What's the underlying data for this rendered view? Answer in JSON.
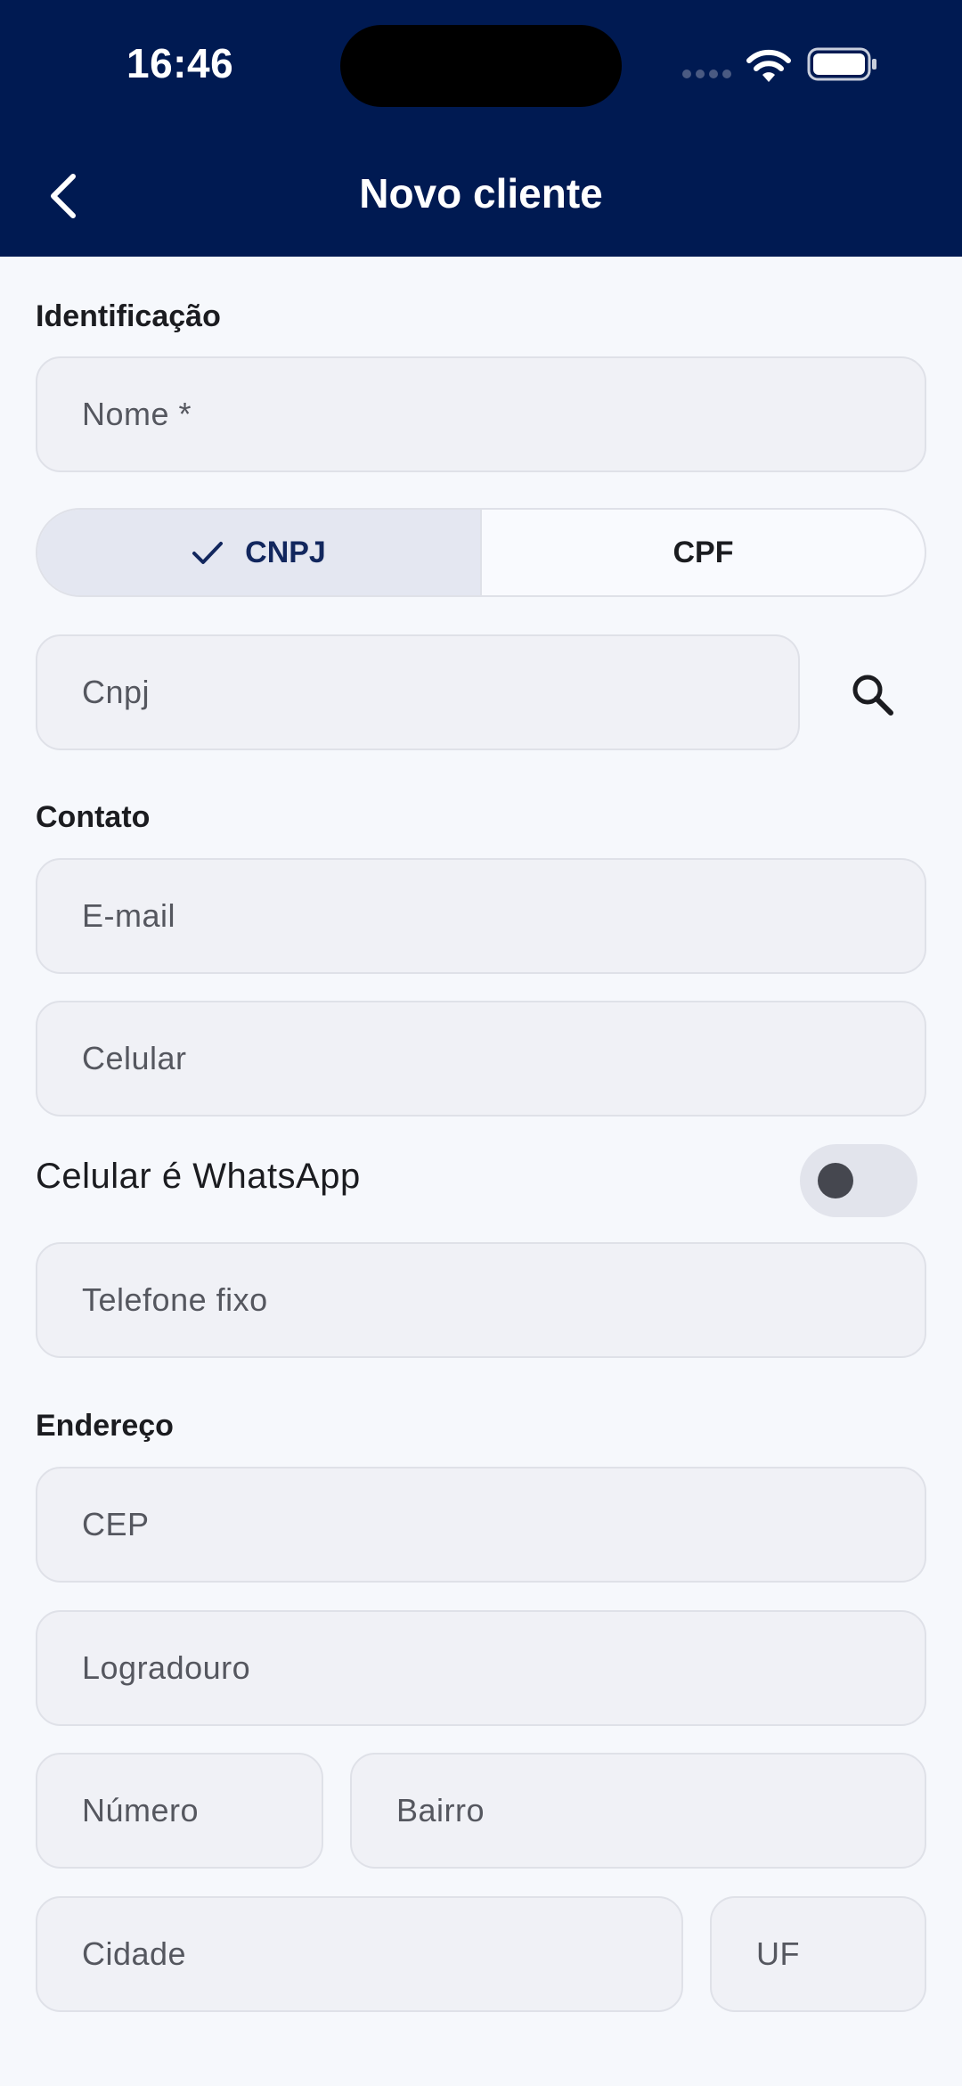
{
  "status_bar": {
    "time": "16:46"
  },
  "header": {
    "title": "Novo cliente"
  },
  "sections": {
    "identificacao": "Identificação",
    "contato": "Contato",
    "endereco": "Endereço"
  },
  "fields": {
    "nome": {
      "placeholder": "Nome *",
      "value": ""
    },
    "cnpj": {
      "placeholder": "Cnpj",
      "value": ""
    },
    "email": {
      "placeholder": "E-mail",
      "value": ""
    },
    "celular": {
      "placeholder": "Celular",
      "value": ""
    },
    "telefone": {
      "placeholder": "Telefone fixo",
      "value": ""
    },
    "cep": {
      "placeholder": "CEP",
      "value": ""
    },
    "logradouro": {
      "placeholder": "Logradouro",
      "value": ""
    },
    "numero": {
      "placeholder": "Número",
      "value": ""
    },
    "bairro": {
      "placeholder": "Bairro",
      "value": ""
    },
    "cidade": {
      "placeholder": "Cidade",
      "value": ""
    },
    "uf": {
      "placeholder": "UF",
      "value": ""
    }
  },
  "document_type": {
    "options": [
      "CNPJ",
      "CPF"
    ],
    "selected": "CNPJ"
  },
  "whatsapp_toggle": {
    "label": "Celular é WhatsApp",
    "on": false
  },
  "icons": {
    "back": "chevron-left-icon",
    "check": "check-icon",
    "search": "search-icon",
    "wifi": "wifi-icon",
    "battery": "battery-icon",
    "signal": "signal-icon"
  },
  "colors": {
    "header_bg": "#001a52",
    "page_bg": "#f6f8fc",
    "field_bg": "#f0f1f6",
    "segment_active_bg": "#e4e7f1",
    "segment_active_text": "#12275e"
  }
}
